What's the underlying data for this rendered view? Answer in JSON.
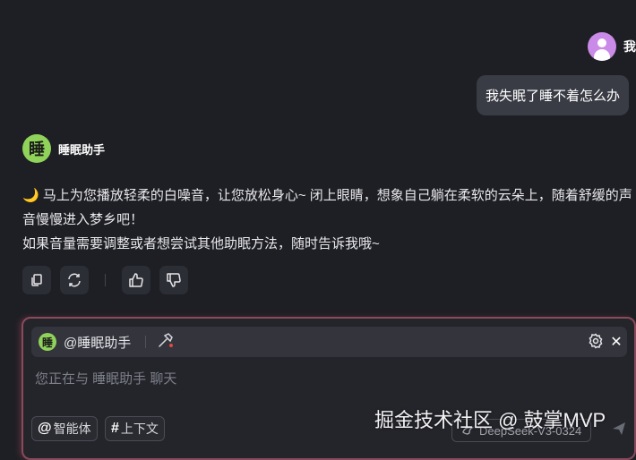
{
  "user": {
    "name": "我",
    "message": "我失眠了睡不着怎么办"
  },
  "assistant": {
    "avatar_char": "睡",
    "name": "睡眠助手",
    "emoji": "🌙",
    "line1": "马上为您播放轻柔的白噪音，让您放松身心~ 闭上眼睛，想象自己躺在柔软的云朵上，随着舒缓的声音慢慢进入梦乡吧！",
    "line2": "如果音量需要调整或者想尝试其他助眠方法，随时告诉我哦~"
  },
  "composer": {
    "avatar_char": "睡",
    "mention": "@睡眠助手",
    "placeholder": "您正在与 睡眠助手 聊天",
    "chip_agent": "智能体",
    "chip_context": "上下文",
    "model": "DeepSeek-V3-0324",
    "close": "✕"
  },
  "watermark": "掘金技术社区 @ 鼓掌MVP",
  "colors": {
    "background": "#1e1f24",
    "bubble": "#3a3c45",
    "assistant_avatar": "#8fd35a",
    "user_avatar": "#c98ae8",
    "composer_border": "#8a4a5a"
  }
}
